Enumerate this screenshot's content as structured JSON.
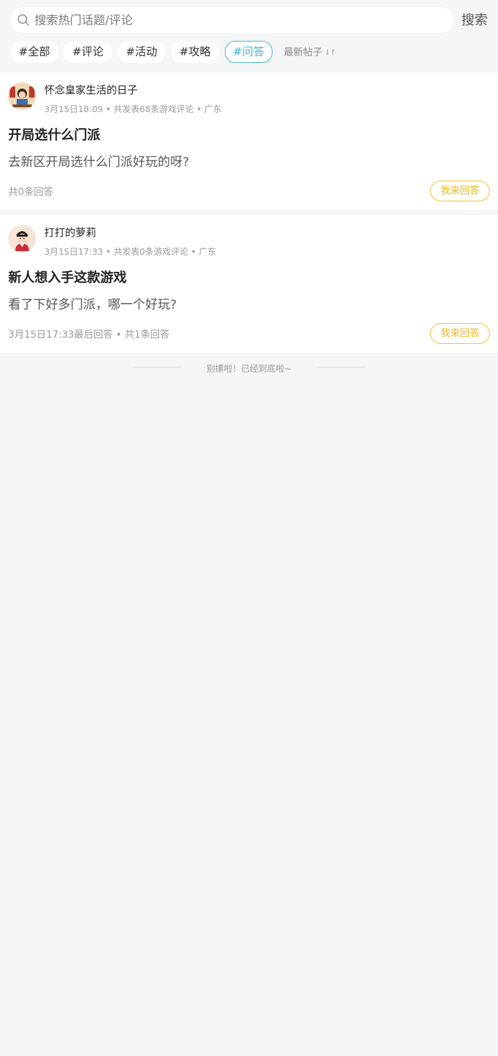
{
  "search": {
    "placeholder": "搜索热门话题/评论",
    "button_label": "搜索"
  },
  "tags": [
    {
      "label": "#全部",
      "active": false
    },
    {
      "label": "#评论",
      "active": false
    },
    {
      "label": "#活动",
      "active": false
    },
    {
      "label": "#攻略",
      "active": false
    },
    {
      "label": "#问答",
      "active": true
    }
  ],
  "sort": {
    "label": "最新帖子",
    "icon": "sort-arrows-icon"
  },
  "posts": [
    {
      "username": "怀念皇家生活的日子",
      "meta": "3月15日18:09 • 共发表68条游戏评论 • 广东",
      "title": "开局选什么门派",
      "body": "去新区开局选什么门派好玩的呀?",
      "footer": "共0条回答",
      "answer_label": "我来回答"
    },
    {
      "username": "打打的萝莉",
      "meta": "3月15日17:33 • 共发表0条游戏评论 • 广东",
      "title": "新人想入手这款游戏",
      "body": "看了下好多门派，哪一个好玩?",
      "footer": "3月15日17:33最后回答 • 共1条回答",
      "answer_label": "我来回答"
    }
  ],
  "end_message": "别摞啦！已经到底啦~",
  "colors": {
    "accent": "#45b3d1",
    "answer_button": "#f0b41e",
    "background": "#f4f5f7"
  }
}
